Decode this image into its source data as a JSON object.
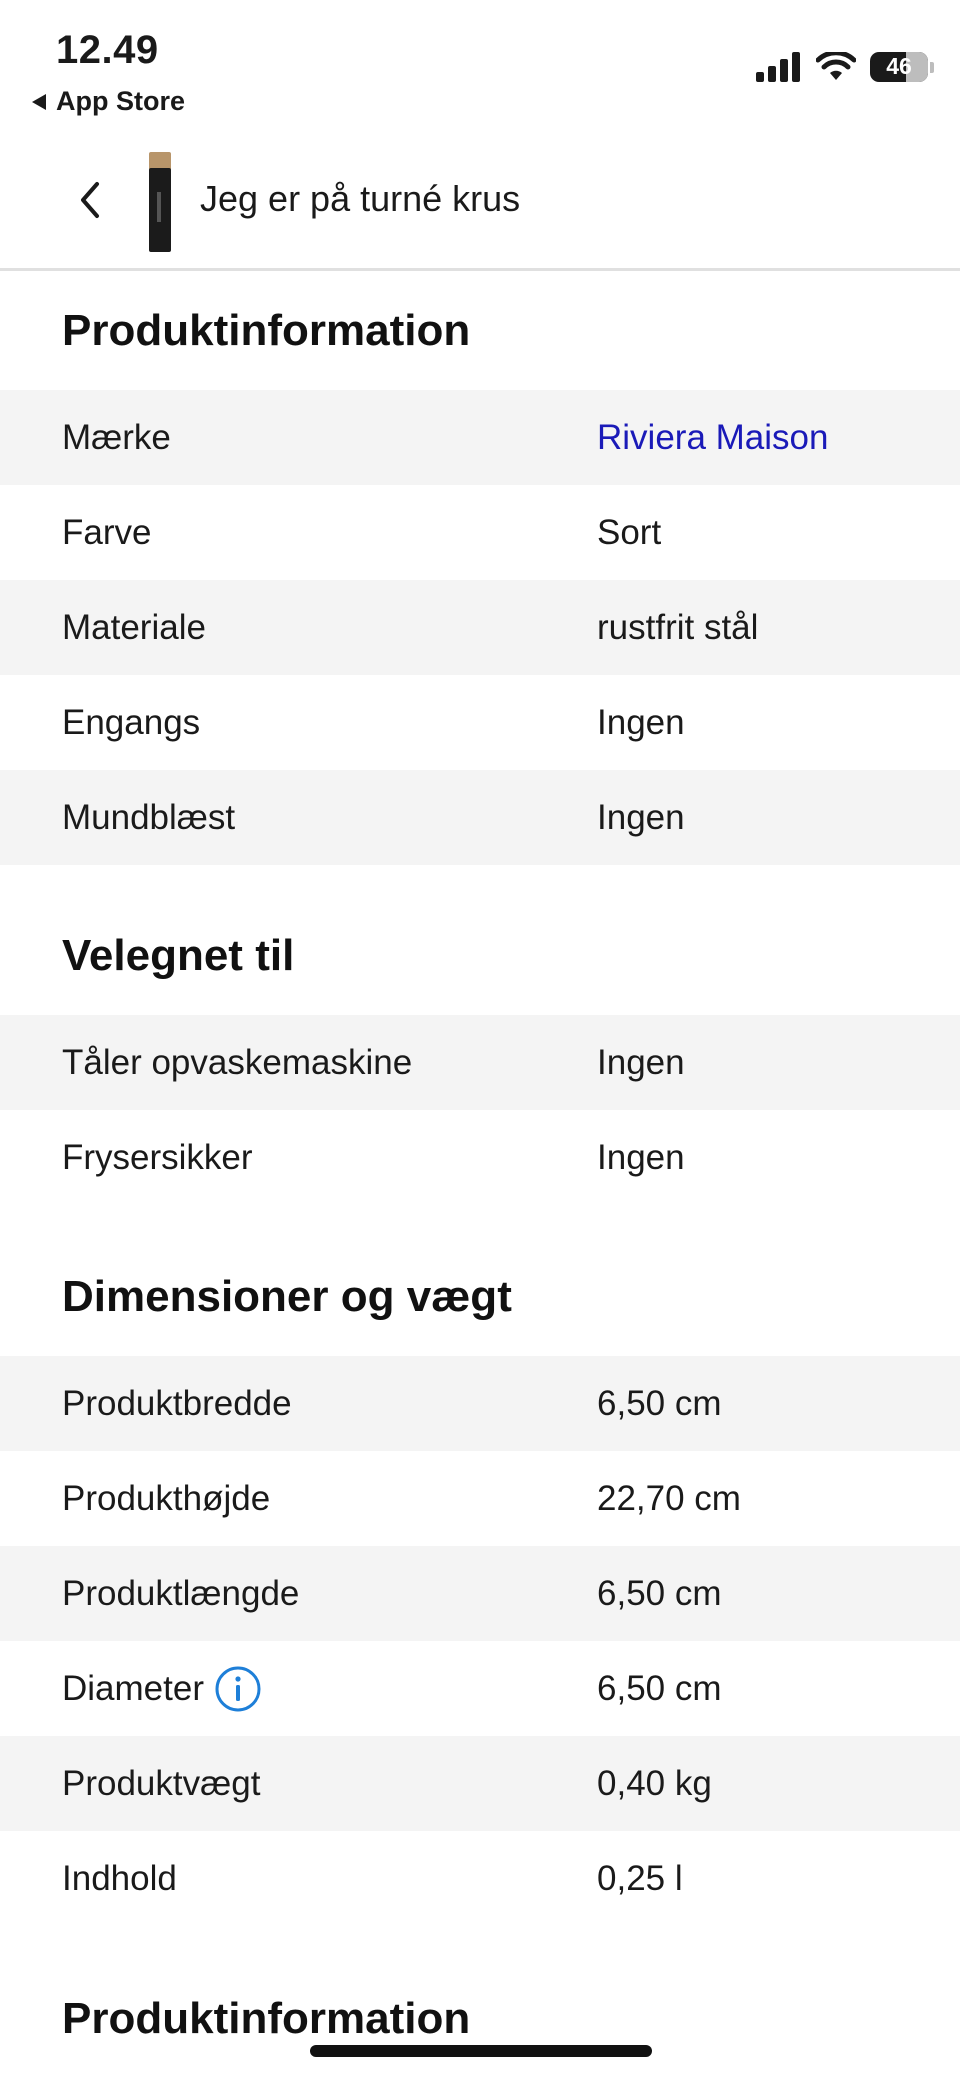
{
  "status_bar": {
    "time": "12.49",
    "back_app": "App Store",
    "battery": "46"
  },
  "header": {
    "title": "Jeg er på turné krus"
  },
  "sections": [
    {
      "title": "Produktinformation",
      "rows": [
        {
          "label": "Mærke",
          "value": "Riviera Maison"
        },
        {
          "label": "Farve",
          "value": "Sort"
        },
        {
          "label": "Materiale",
          "value": "rustfrit stål"
        },
        {
          "label": "Engangs",
          "value": "Ingen"
        },
        {
          "label": "Mundblæst",
          "value": "Ingen"
        }
      ]
    },
    {
      "title": "Velegnet til",
      "rows": [
        {
          "label": "Tåler opvaskemaskine",
          "value": "Ingen"
        },
        {
          "label": "Frysersikker",
          "value": "Ingen"
        }
      ]
    },
    {
      "title": "Dimensioner og vægt",
      "rows": [
        {
          "label": "Produktbredde",
          "value": "6,50 cm"
        },
        {
          "label": "Produkthøjde",
          "value": "22,70 cm"
        },
        {
          "label": "Produktlængde",
          "value": "6,50 cm"
        },
        {
          "label": "Diameter",
          "value": "6,50 cm"
        },
        {
          "label": "Produktvægt",
          "value": "0,40 kg"
        },
        {
          "label": "Indhold",
          "value": "0,25 l"
        }
      ]
    },
    {
      "title": "Produktinformation",
      "rows": []
    }
  ],
  "colors": {
    "link": "#1a1ab8",
    "info_icon": "#1e7fd8",
    "row_shade": "#f4f4f4"
  }
}
